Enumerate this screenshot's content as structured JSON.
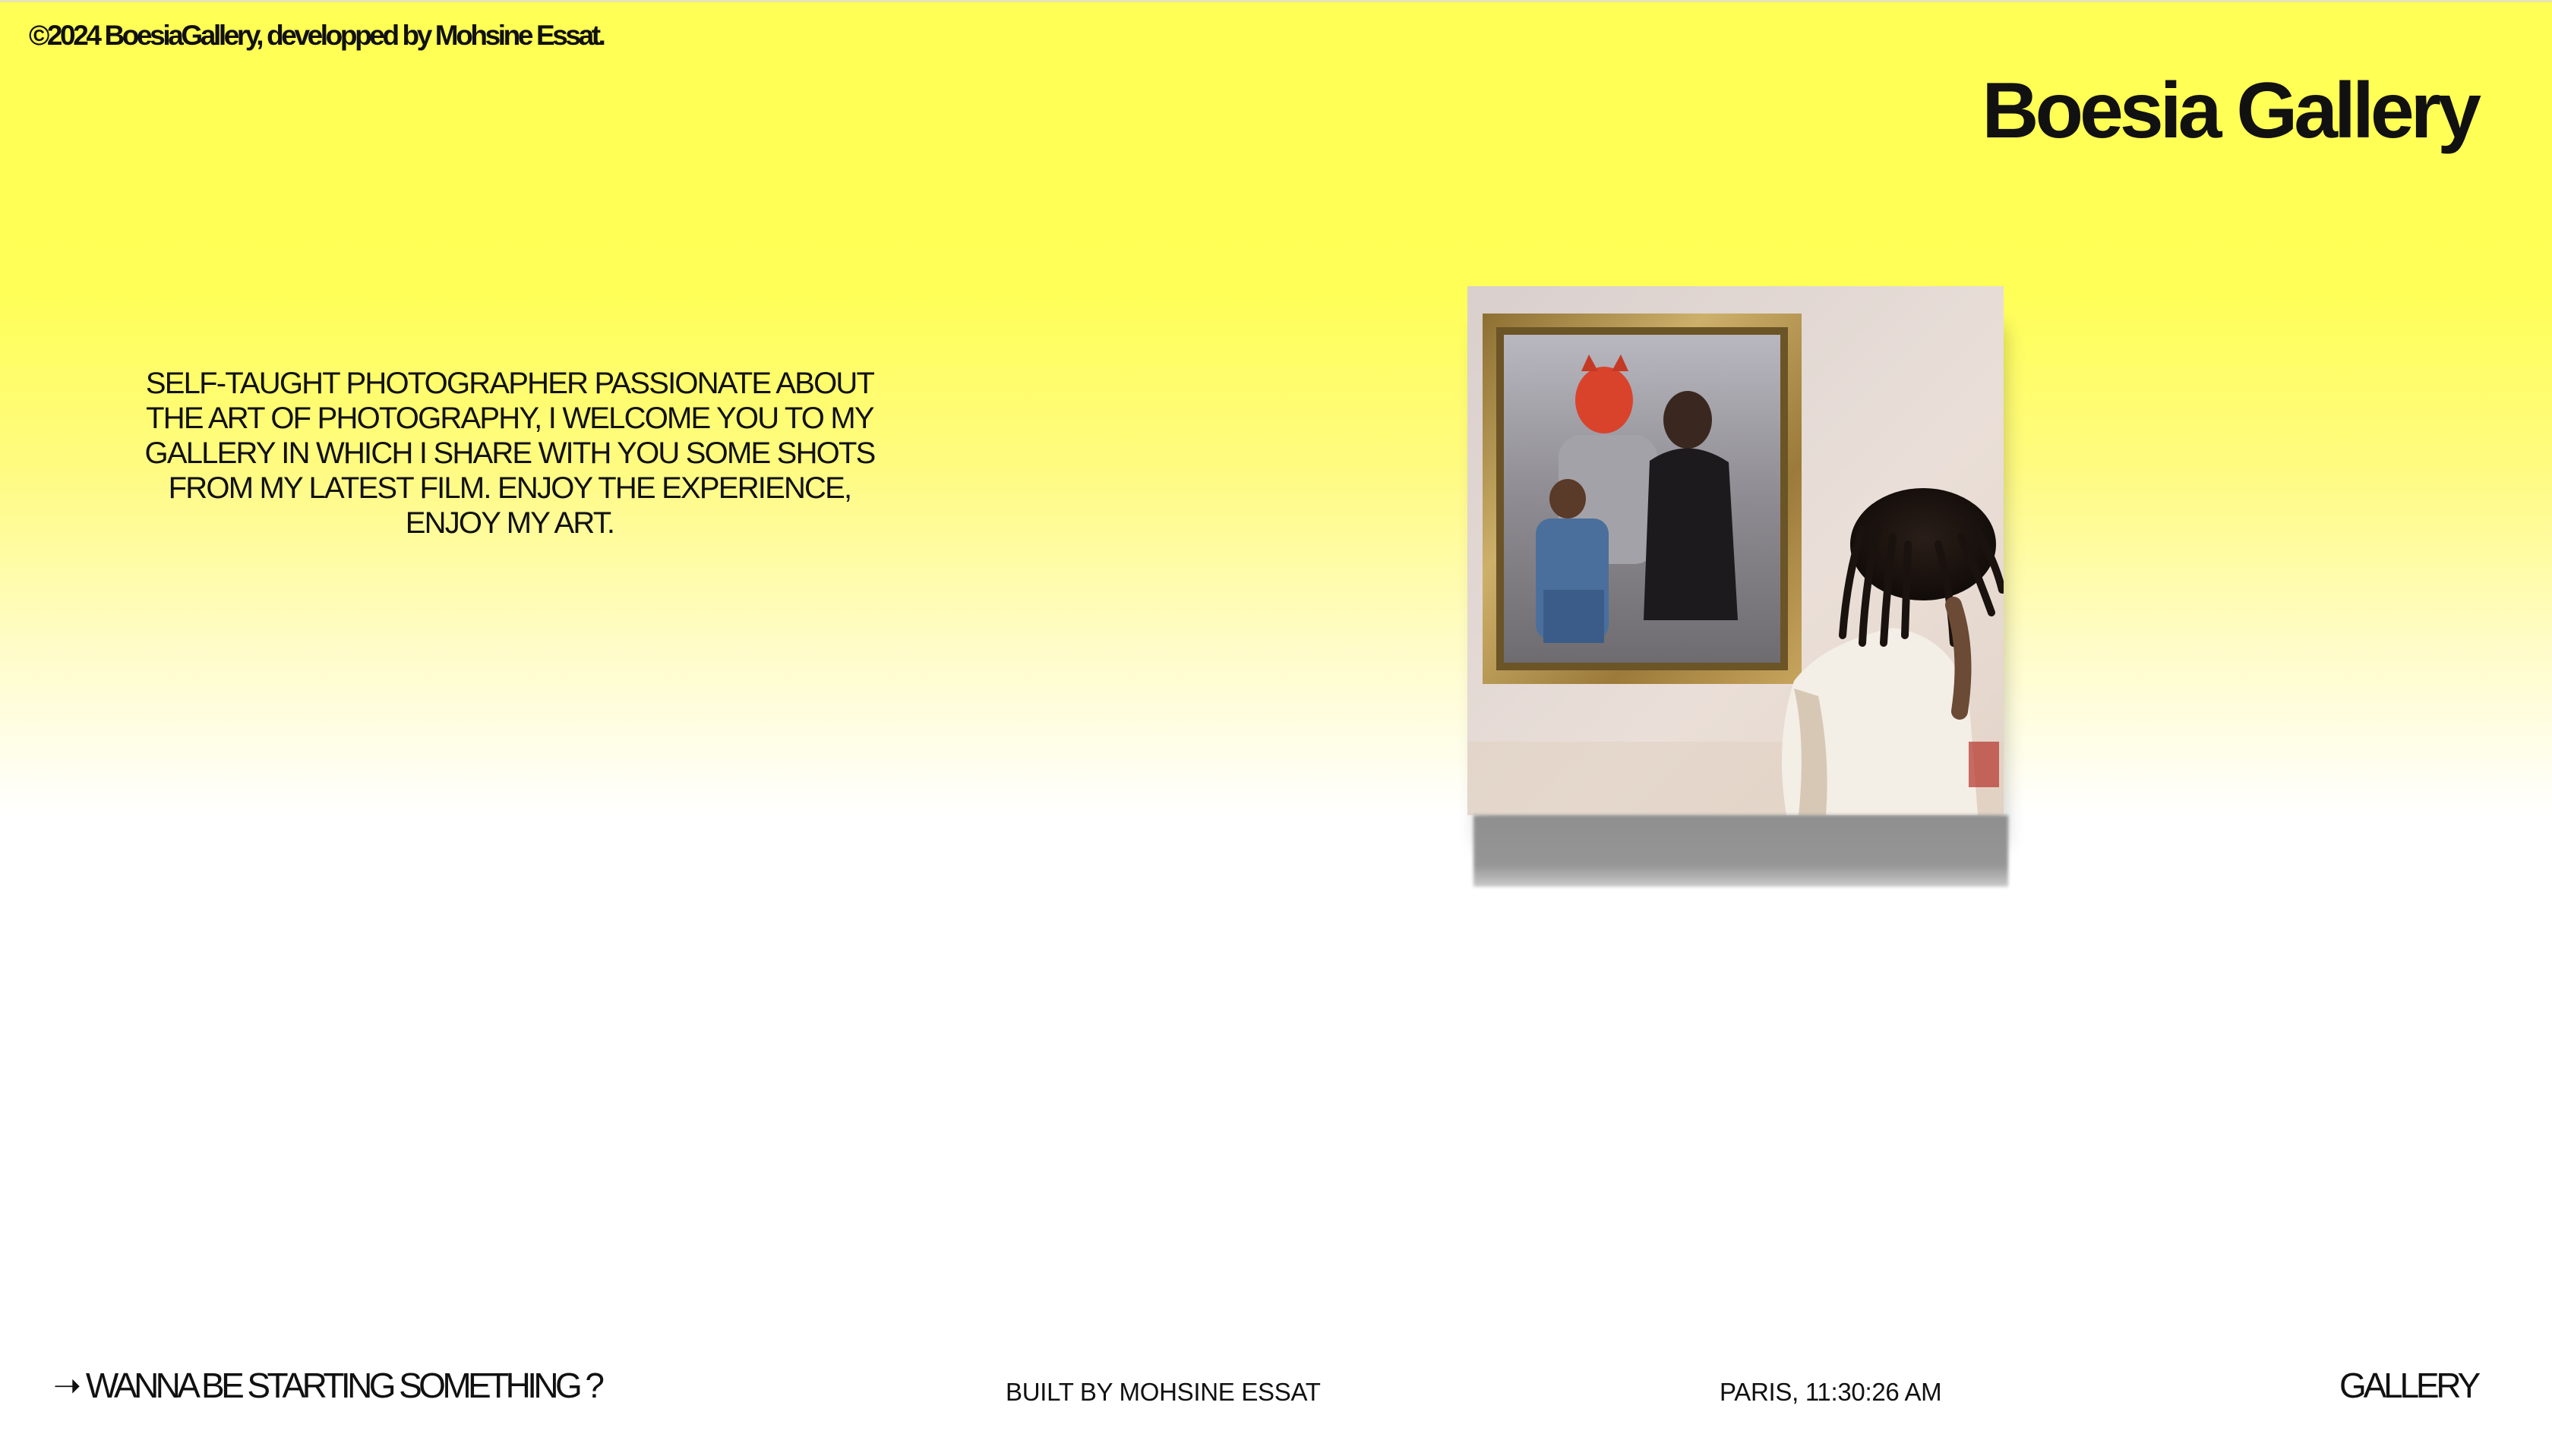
{
  "header": {
    "copyright": "©2024 BoesiaGallery, developped by Mohsine Essat.",
    "brand_title": "Boesia Gallery"
  },
  "intro": {
    "text": "SELF-TAUGHT PHOTOGRAPHER PASSIONATE ABOUT THE ART OF PHOTOGRAPHY, I WELCOME YOU TO MY GALLERY IN WHICH I SHARE WITH YOU SOME SHOTS FROM MY LATEST FILM. ENJOY THE EXPERIENCE, ENJOY MY ART."
  },
  "photo": {
    "alt_icon": "featured-photo"
  },
  "footer": {
    "cta_arrow": "➝",
    "cta_label": "WANNA BE STARTING SOMETHING ?",
    "built_by": "BUILT BY MOHSINE ESSAT",
    "clock": "PARIS, 11:30:26 AM",
    "nav_gallery": "GALLERY"
  },
  "colors": {
    "background_top": "#ffff55",
    "background_bottom": "#ffffff",
    "text": "#111111"
  }
}
